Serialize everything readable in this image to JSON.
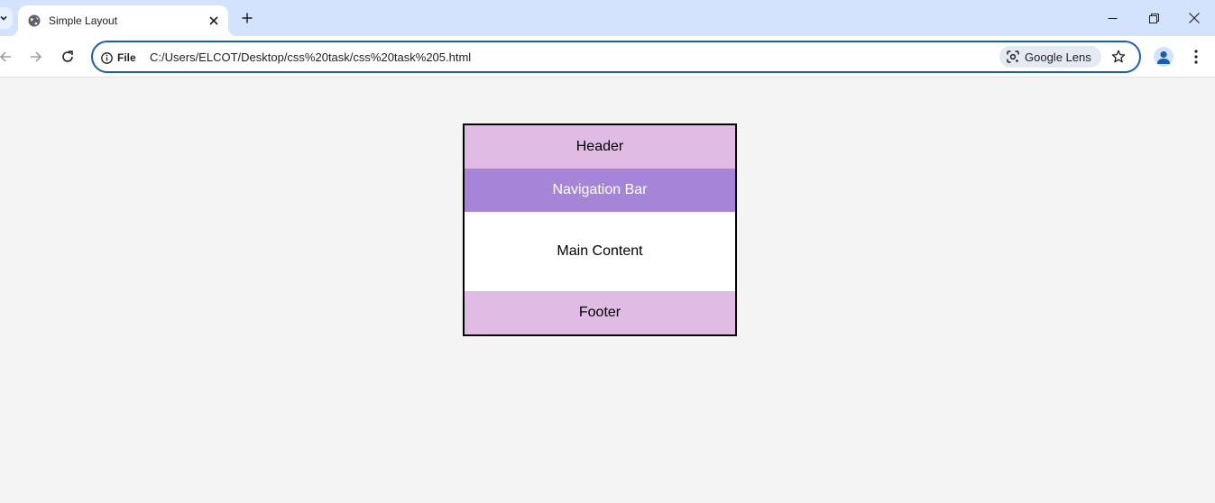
{
  "browser": {
    "tab": {
      "title": "Simple Layout",
      "favicon": "globe-icon"
    },
    "address_bar": {
      "site_info_label": "File",
      "url": "C:/Users/ELCOT/Desktop/css%20task/css%20task%205.html",
      "lens_label": "Google Lens"
    },
    "accent": "#1a5eae",
    "tabstrip_color": "#d3e3fd"
  },
  "page": {
    "background": "#f4f4f4",
    "header": "Header",
    "nav": "Navigation Bar",
    "main": "Main Content",
    "footer": "Footer",
    "colors": {
      "header": "#e0bbe4",
      "nav": "#a685d8",
      "main": "#ffffff",
      "footer": "#e0bbe4"
    }
  }
}
